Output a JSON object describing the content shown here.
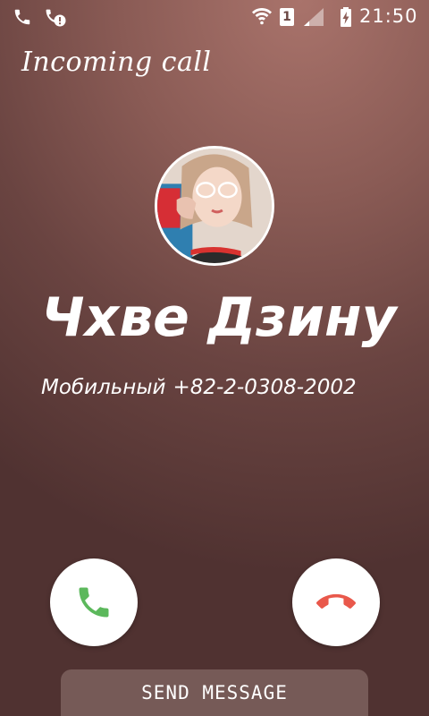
{
  "status_bar": {
    "sim_slot": "1",
    "time": "21:50",
    "icons": [
      "phone-icon",
      "call-alert-icon",
      "wifi-icon",
      "sim-icon",
      "signal-icon",
      "battery-charging-icon"
    ]
  },
  "call": {
    "label": "Incoming call",
    "contact_name": "Чхве Дзину",
    "number_type": "Мобильный",
    "number": "+82-2-0308-2002"
  },
  "actions": {
    "answer_icon": "phone-answer-icon",
    "decline_icon": "phone-hangup-icon",
    "send_message_label": "SEND MESSAGE"
  },
  "colors": {
    "answer": "#5cb85c",
    "decline": "#e9584b",
    "background_top": "#a9736b",
    "background_bottom": "#503231"
  }
}
